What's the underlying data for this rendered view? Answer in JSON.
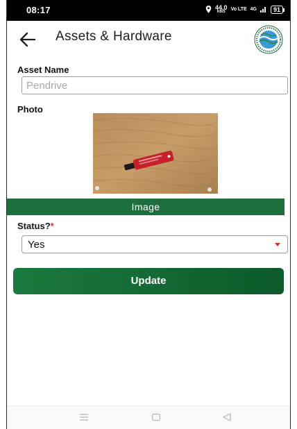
{
  "status_bar": {
    "time": "08:17",
    "speed": "44.0",
    "speed_unit": "KB/S",
    "net1": "Vo LTE",
    "net2": "4G",
    "battery": "91"
  },
  "app_bar": {
    "title": "Assets & Hardware",
    "back_icon": "back-arrow-icon",
    "logo_icon": "org-logo-icon"
  },
  "form": {
    "asset_name_label": "Asset Name",
    "asset_name_placeholder": "Pendrive",
    "photo_label": "Photo",
    "image_button_label": "Image",
    "status_label": "Status?",
    "status_required_mark": "*",
    "status_value": "Yes",
    "update_button_label": "Update"
  },
  "colors": {
    "accent": "#1d6f3d",
    "required": "#d32f2f",
    "status_bar": "#000000"
  },
  "nav_bar": {
    "icons": [
      "menu-icon",
      "home-icon",
      "back-icon"
    ]
  }
}
